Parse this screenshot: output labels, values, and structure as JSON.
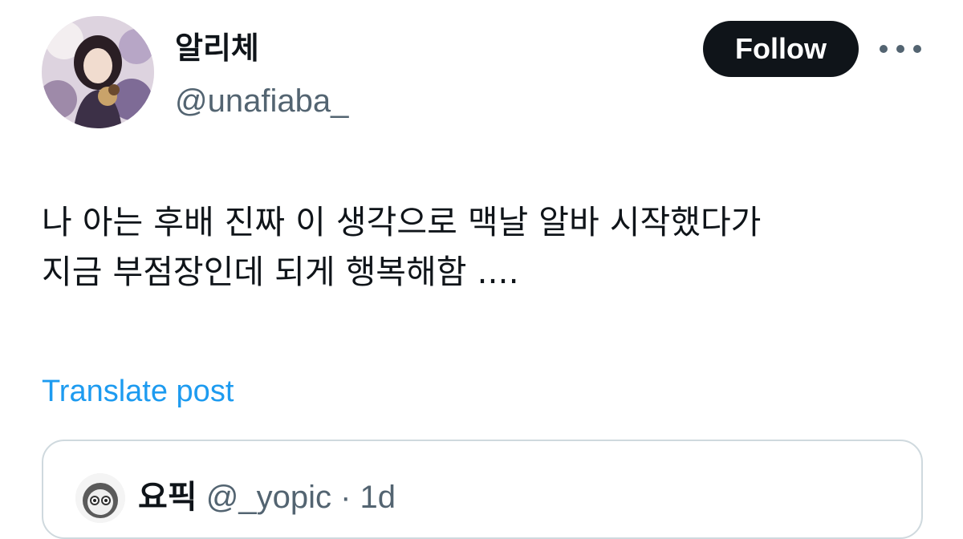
{
  "author": {
    "display_name": "알리체",
    "handle": "@unafiaba_"
  },
  "actions": {
    "follow_label": "Follow"
  },
  "post": {
    "text_lines": [
      "나 아는 후배 진짜 이 생각으로 맥날 알바 시작했다가",
      "지금 부점장인데 되게 행복해함 ...."
    ],
    "translate_label": "Translate post"
  },
  "quoted_post": {
    "display_name": "요픽",
    "handle": "@_yopic",
    "time": "· 1d"
  },
  "colors": {
    "text_primary": "#0f1419",
    "text_secondary": "#536471",
    "link": "#1d9bf0",
    "button_bg": "#0f1419",
    "border": "#cfd9de"
  },
  "icons": {
    "more": "more-horizontal-icon"
  }
}
